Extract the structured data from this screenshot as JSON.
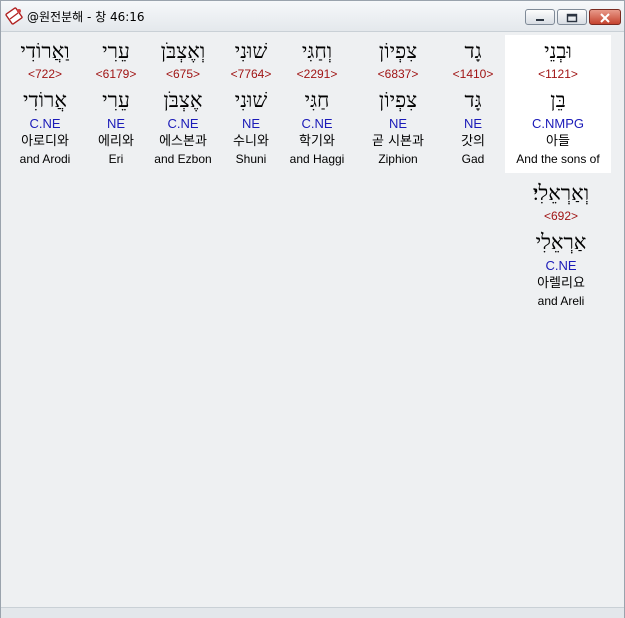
{
  "window": {
    "title": "@원전분해 - 창 46:16",
    "icon": "bible-book-icon"
  },
  "colors": {
    "strong_number": "#a01515",
    "morphology": "#1a1ab8",
    "selected_bg": "#ffffff"
  },
  "words": [
    {
      "hebrew": "וּבְנֵי",
      "strong": "<1121>",
      "lemma": "בֵּן",
      "morph": "C.NMPG",
      "korean": "아들",
      "english": "And the sons of",
      "selected": true
    },
    {
      "hebrew": "גָד",
      "strong": "<1410>",
      "lemma": "גָּד",
      "morph": "NE",
      "korean": "갓의",
      "english": "Gad"
    },
    {
      "hebrew": "צִפְיוֹן",
      "strong": "<6837>",
      "lemma": "צִפְיוֹן",
      "morph": "NE",
      "korean": "곧 시뵨과",
      "english": "Ziphion"
    },
    {
      "hebrew": "וְחַגִּי",
      "strong": "<2291>",
      "lemma": "חַגִּי",
      "morph": "C.NE",
      "korean": "학기와",
      "english": "and Haggi"
    },
    {
      "hebrew": "שׁוּנִי",
      "strong": "<7764>",
      "lemma": "שׁוּנִי",
      "morph": "NE",
      "korean": "수니와",
      "english": "Shuni"
    },
    {
      "hebrew": "וְאֶצְבֹּן",
      "strong": "<675>",
      "lemma": "אֶצְבֹּן",
      "morph": "C.NE",
      "korean": "에스본과",
      "english": "and Ezbon"
    },
    {
      "hebrew": "עֵרִי",
      "strong": "<6179>",
      "lemma": "עֵרִי",
      "morph": "NE",
      "korean": "에리와",
      "english": "Eri"
    },
    {
      "hebrew": "וַאֲרוֹדִי",
      "strong": "<722>",
      "lemma": "אֲרוֹדִי",
      "morph": "C.NE",
      "korean": "아로디와",
      "english": "and Arodi"
    },
    {
      "hebrew": "וְאַרְאֵלִי׃",
      "strong": "<692>",
      "lemma": "אַרְאֵלִי",
      "morph": "C.NE",
      "korean": "아렐리요",
      "english": "and Areli"
    }
  ]
}
